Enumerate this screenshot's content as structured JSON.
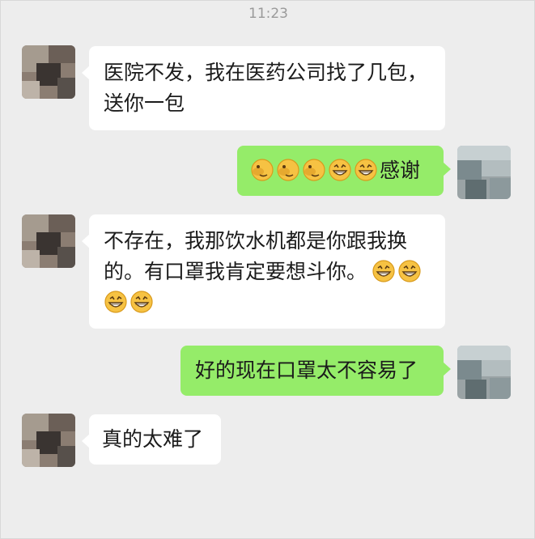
{
  "time": "11:23",
  "messages": [
    {
      "side": "in",
      "text": "医院不发，我在医药公司找了几包，送你一包"
    },
    {
      "side": "out",
      "text": "感谢",
      "emojis": [
        "facepalm-emoji",
        "facepalm-emoji",
        "facepalm-emoji",
        "grin-emoji",
        "grin-emoji"
      ]
    },
    {
      "side": "in",
      "text": "不存在，我那饮水机都是你跟我换的。有口罩我肯定要想斗你。",
      "emojis_after": [
        "grin-emoji",
        "grin-emoji",
        "grin-emoji",
        "grin-emoji"
      ]
    },
    {
      "side": "out",
      "text": "好的现在口罩太不容易了"
    },
    {
      "side": "in",
      "text": "真的太难了"
    }
  ],
  "colors": {
    "incoming_bubble": "#ffffff",
    "outgoing_bubble": "#95ec69",
    "background": "#ededed"
  }
}
